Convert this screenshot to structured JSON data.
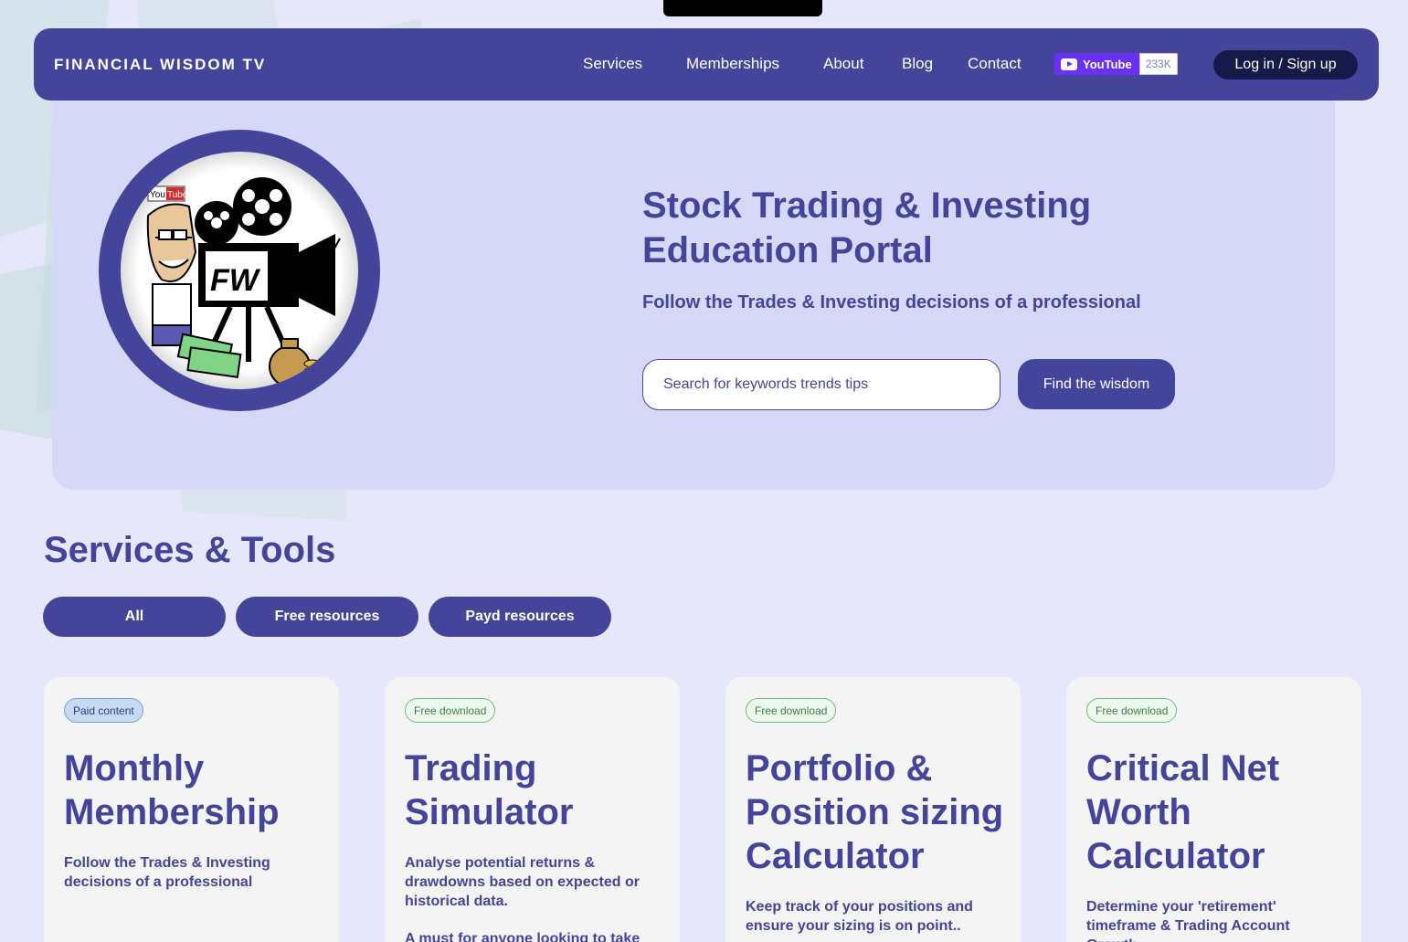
{
  "nav": {
    "brand": "FINANCIAL WISDOM TV",
    "links": [
      "Services",
      "Memberships",
      "About",
      "Blog",
      "Contact"
    ],
    "youtube_label": "YouTube",
    "youtube_count": "233K",
    "login_label": "Log in / Sign up"
  },
  "hero": {
    "title": "Stock Trading & Investing Education Portal",
    "subtitle": "Follow the Trades & Investing decisions of a professional",
    "search_placeholder": "Search for keywords trends tips",
    "search_button": "Find the wisdom",
    "logo_text": "FW",
    "logo_badge": "YouTube"
  },
  "services": {
    "title": "Services & Tools",
    "filters": [
      "All",
      "Free resources",
      "Payd resources"
    ],
    "cards": [
      {
        "badge": "Paid content",
        "title": "Monthly Membership",
        "desc": "Follow the Trades & Investing decisions of a professional",
        "desc2": ""
      },
      {
        "badge": "Free download",
        "title": "Trading Simulator",
        "desc": "Analyse potential returns & drawdowns based on expected or historical data.",
        "desc2": "A must for anyone looking to take"
      },
      {
        "badge": "Free download",
        "title": "Portfolio & Position sizing Calculator",
        "desc": "Keep track of your positions and ensure your sizing is on point..",
        "desc2": ""
      },
      {
        "badge": "Free download",
        "title": "Critical Net Worth Calculator",
        "desc": "Determine your 'retirement' timeframe & Trading Account Growth",
        "desc2": ""
      }
    ]
  },
  "colors": {
    "primary": "#45449b",
    "background": "#e6e7fb",
    "hero_panel": "#d5d8f7",
    "login_button": "#151a4a",
    "youtube": "#6a30f5"
  }
}
